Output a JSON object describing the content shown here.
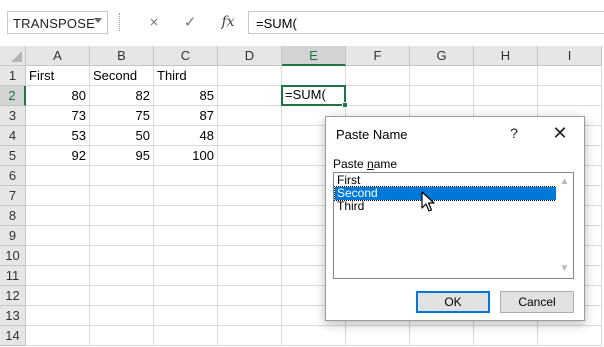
{
  "name_box": {
    "value": "TRANSPOSE"
  },
  "formula_bar": {
    "cancel_icon": "×",
    "enter_icon": "✓",
    "insert_function_label": "fx",
    "formula": "=SUM("
  },
  "columns": [
    "A",
    "B",
    "C",
    "D",
    "E",
    "F",
    "G",
    "H",
    "I"
  ],
  "active_column": "E",
  "rows": [
    "1",
    "2",
    "3",
    "4",
    "5",
    "6",
    "7",
    "8",
    "9",
    "10",
    "11",
    "12",
    "13",
    "14"
  ],
  "active_row": "2",
  "cells": {
    "A1": "First",
    "B1": "Second",
    "C1": "Third",
    "A2": "80",
    "B2": "82",
    "C2": "85",
    "A3": "73",
    "B3": "75",
    "C3": "87",
    "A4": "53",
    "B4": "50",
    "C4": "48",
    "A5": "92",
    "B5": "95",
    "C5": "100",
    "E2": "=SUM("
  },
  "dialog": {
    "title": "Paste Name",
    "help_icon": "?",
    "close_icon": "✕",
    "label_prefix": "Paste ",
    "label_underlined": "n",
    "label_suffix": "ame",
    "items": [
      "First",
      "Second",
      "Third"
    ],
    "selected_item": "Second",
    "ok_label": "OK",
    "cancel_label": "Cancel"
  },
  "colors": {
    "accent": "#217346",
    "selection": "#0078d7"
  }
}
